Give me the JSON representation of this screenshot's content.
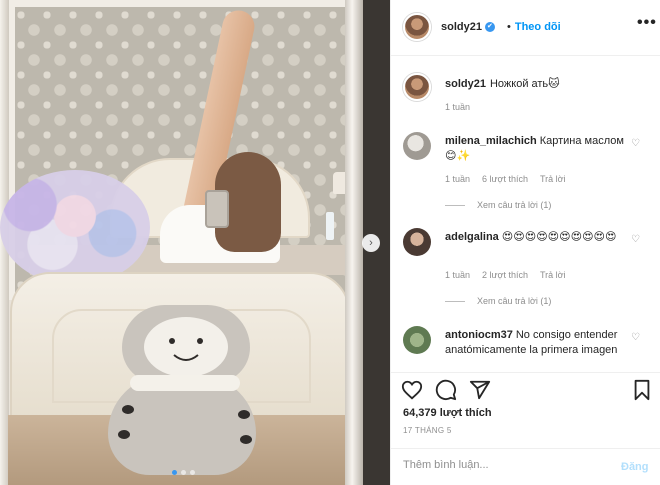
{
  "post": {
    "username": "soldy21",
    "follow_label": "Theo dõi",
    "separator": "•",
    "more_label": "•••",
    "verified_mark": "✔",
    "caption": "Ножкой ать🐱",
    "caption_time": "1 tuần"
  },
  "photo": {
    "next_arrow": "›",
    "slide_count": 3,
    "active_slide": 1
  },
  "comments": [
    {
      "username": "milena_milachich",
      "text": "Картина маслом😊✨",
      "time": "1 tuần",
      "likes": "6 lượt thích",
      "reply": "Trả lời",
      "view_replies": "Xem câu trả lời (1)"
    },
    {
      "username": "adelgalina",
      "text": "😍😍😍😍😍😍😍😍😍😍",
      "time": "1 tuần",
      "likes": "2 lượt thích",
      "reply": "Trả lời",
      "view_replies": "Xem câu trả lời (1)"
    },
    {
      "username": "antoniocm37",
      "text": "No consigo entender anatómicamente la primera imagen"
    }
  ],
  "actions": {
    "likes": "64,379 lượt thích",
    "date": "17 THÁNG 5"
  },
  "add_comment": {
    "placeholder": "Thêm bình luận...",
    "post_label": "Đăng"
  },
  "colors": {
    "accent": "#0095f6",
    "post_disabled": "#b2dffc",
    "muted": "#8e8e8e"
  },
  "icons": [
    "heart-icon",
    "comment-icon",
    "share-icon",
    "bookmark-icon",
    "verified-icon",
    "more-icon",
    "chevron-right-icon"
  ]
}
